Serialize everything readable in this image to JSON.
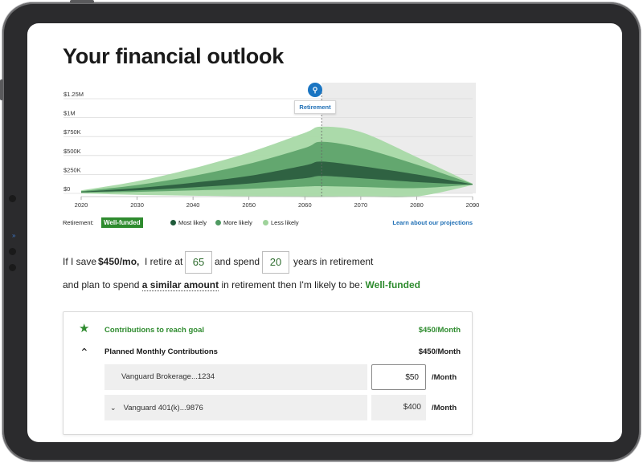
{
  "title": "Your financial outlook",
  "retirement_marker": {
    "icon": "retirement-person-icon",
    "glyph": "⚲",
    "label": "Retirement"
  },
  "chart_data": {
    "type": "area",
    "x_ticks": [
      "2020",
      "2030",
      "2040",
      "2050",
      "2060",
      "2070",
      "2080",
      "2090"
    ],
    "y_ticks": [
      "$0",
      "$250K",
      "$500K",
      "$750K",
      "$1M",
      "$1.25M"
    ],
    "ylim": [
      0,
      1250000
    ],
    "xlim": [
      2020,
      2090
    ],
    "retirement_year": 2063,
    "series": [
      {
        "name": "Less likely",
        "color": "#a8d9a6",
        "x": [
          2020,
          2030,
          2040,
          2050,
          2060,
          2063,
          2070,
          2080,
          2090
        ],
        "upper": [
          40000,
          160000,
          330000,
          540000,
          800000,
          880000,
          810000,
          480000,
          130000
        ],
        "lower": [
          0,
          -20000,
          -30000,
          -40000,
          -50000,
          -50000,
          -45000,
          -40000,
          110000
        ]
      },
      {
        "name": "More likely",
        "color": "#5fa46c",
        "x": [
          2020,
          2030,
          2040,
          2050,
          2060,
          2063,
          2070,
          2080,
          2090
        ],
        "upper": [
          30000,
          110000,
          230000,
          390000,
          600000,
          680000,
          600000,
          380000,
          125000
        ],
        "lower": [
          10000,
          20000,
          40000,
          60000,
          90000,
          95000,
          85000,
          70000,
          115000
        ]
      },
      {
        "name": "Most likely",
        "color": "#2c5e3f",
        "x": [
          2020,
          2030,
          2040,
          2050,
          2060,
          2063,
          2070,
          2080,
          2090
        ],
        "upper": [
          22000,
          70000,
          140000,
          230000,
          370000,
          420000,
          360000,
          250000,
          120000
        ],
        "lower": [
          15000,
          40000,
          80000,
          130000,
          200000,
          230000,
          200000,
          150000,
          115000
        ]
      }
    ]
  },
  "legend": {
    "retirement_label": "Retirement:",
    "status_badge": "Well-funded",
    "items": [
      {
        "label": "Most likely",
        "color": "#1f5a3a"
      },
      {
        "label": "More likely",
        "color": "#4f9a62"
      },
      {
        "label": "Less likely",
        "color": "#9fd39b"
      }
    ],
    "link": "Learn about our projections"
  },
  "sentence1": {
    "part1": "If I save",
    "amount": "$450/mo,",
    "part2": "I retire at",
    "retire_age": "65",
    "part3": "and spend",
    "years": "20",
    "part4": "years in retirement"
  },
  "sentence2": {
    "part1": "and plan to spend",
    "spend": "a similar amount",
    "part2": "in retirement then I'm likely to be:",
    "status": "Well-funded"
  },
  "panel": {
    "goal_label": "Contributions to reach goal",
    "goal_value": "$450/Month",
    "planned_label": "Planned Monthly Contributions",
    "planned_value": "$450/Month",
    "accounts": [
      {
        "name": "Vanguard Brokerage...1234",
        "amount": "$50",
        "unit": "/Month"
      },
      {
        "name": "Vanguard 401(k)...9876",
        "amount": "$400",
        "unit": "/Month"
      }
    ]
  }
}
